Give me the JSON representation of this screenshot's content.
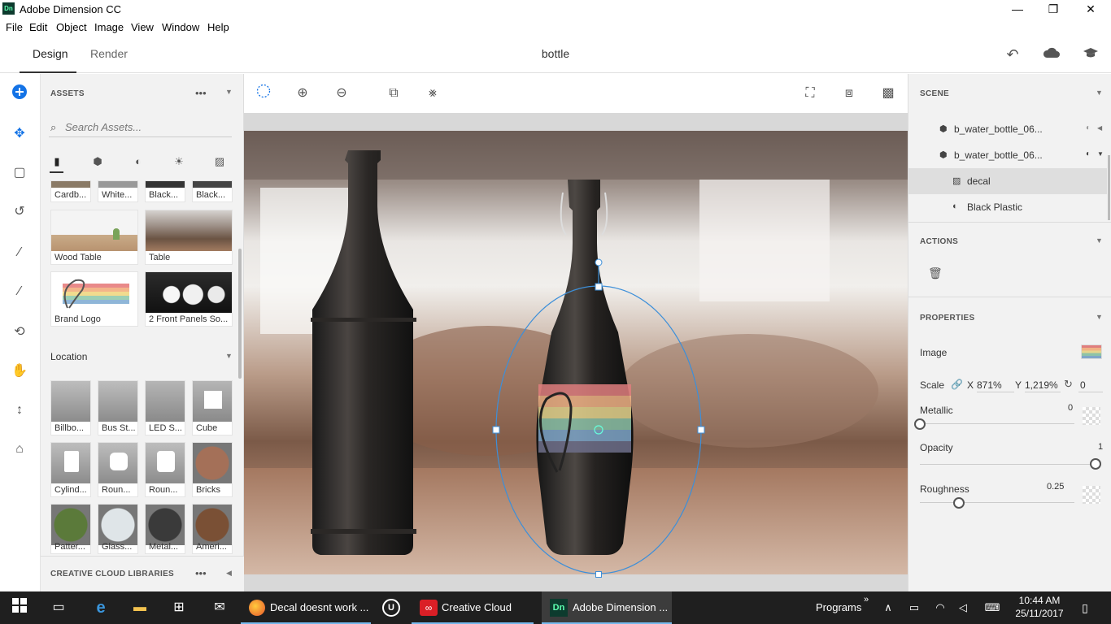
{
  "window": {
    "title": "Adobe Dimension CC",
    "app_badge": "Dn",
    "minimize": "—",
    "maximize": "❐",
    "close": "✕"
  },
  "menu": [
    "File",
    "Edit",
    "Object",
    "Image",
    "View",
    "Window",
    "Help"
  ],
  "header": {
    "tab_design": "Design",
    "tab_render": "Render",
    "document_title": "bottle"
  },
  "assets": {
    "title": "ASSETS",
    "more": "•••",
    "search_placeholder": "Search Assets...",
    "top_row": [
      "Cardb...",
      "White...",
      "Black...",
      "Black..."
    ],
    "models": [
      {
        "label": "Wood Table"
      },
      {
        "label": "Table"
      },
      {
        "label": "Brand Logo"
      },
      {
        "label": "2 Front Panels So..."
      }
    ],
    "location_label": "Location",
    "location_items": [
      "Billbo...",
      "Bus St...",
      "LED S...",
      "Cube",
      "Cylind...",
      "Roun...",
      "Roun...",
      "Bricks",
      "Patter...",
      "Glass...",
      "Metal...",
      "Ameri..."
    ],
    "cc_libraries": "CREATIVE CLOUD LIBRARIES"
  },
  "scene": {
    "title": "SCENE",
    "items": [
      {
        "label": "b_water_bottle_06..."
      },
      {
        "label": "b_water_bottle_06..."
      },
      {
        "label": "decal"
      },
      {
        "label": "Black Plastic"
      }
    ]
  },
  "actions": {
    "title": "ACTIONS"
  },
  "properties": {
    "title": "PROPERTIES",
    "image_label": "Image",
    "scale_label": "Scale",
    "scale_x_label": "X",
    "scale_x": "871%",
    "scale_y_label": "Y",
    "scale_y": "1,219%",
    "rotation": "0",
    "metallic_label": "Metallic",
    "metallic_value": "0",
    "metallic_level": 0,
    "opacity_label": "Opacity",
    "opacity_value": "1",
    "opacity_level": 1,
    "roughness_label": "Roughness",
    "roughness_value": "0.25",
    "roughness_level": 0.25
  },
  "taskbar": {
    "apps": [
      {
        "label": "Decal doesnt work ..."
      },
      {
        "label": "Creative Cloud"
      },
      {
        "label": "Adobe Dimension ..."
      }
    ],
    "programs": "Programs",
    "time": "10:44 AM",
    "date": "25/11/2017"
  },
  "colors": {
    "accent": "#1473e6",
    "selection": "#3d8fd9",
    "taskbar": "#1f1f1f"
  }
}
